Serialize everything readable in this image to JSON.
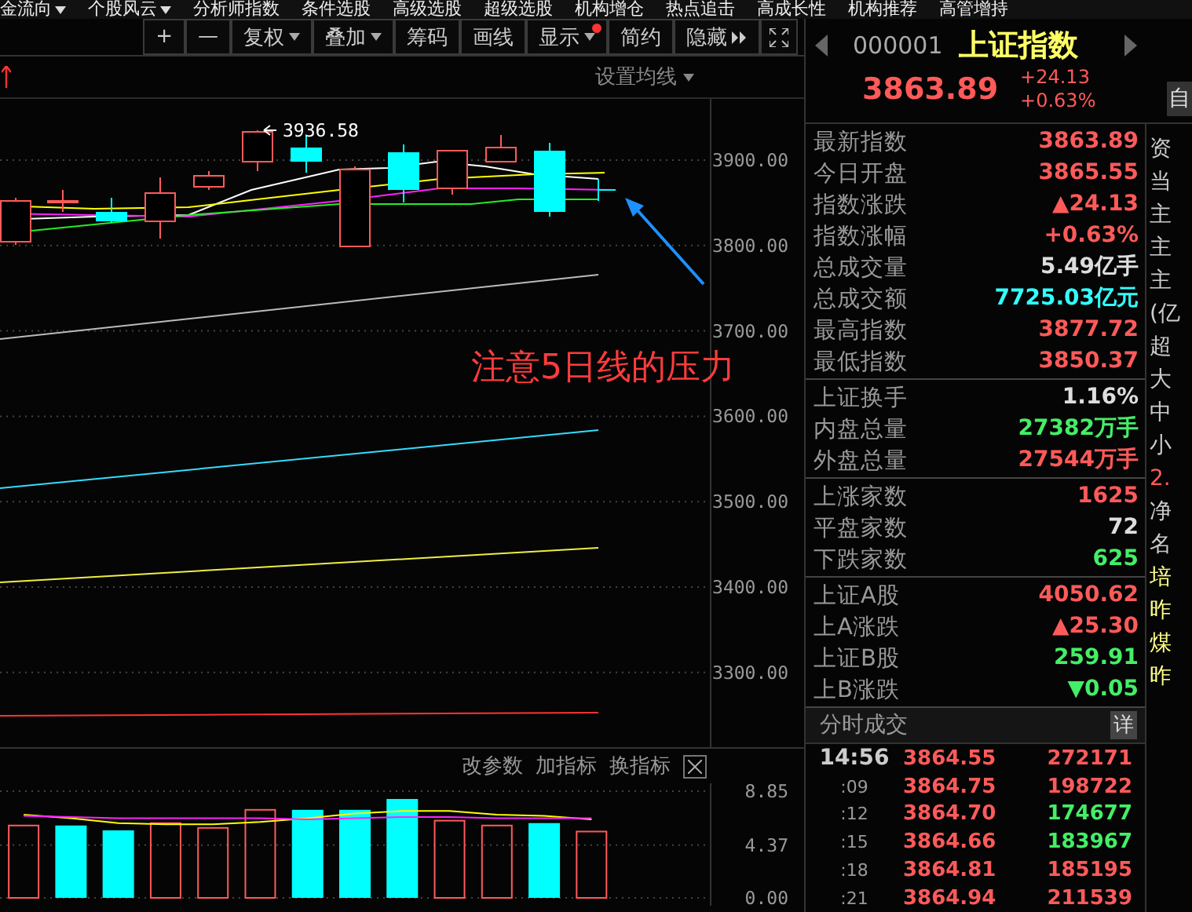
{
  "top_menu": [
    {
      "label": "金流向",
      "dropdown": true
    },
    {
      "label": "个股风云",
      "dropdown": true
    },
    {
      "label": "分析师指数",
      "dropdown": false
    },
    {
      "label": "条件选股",
      "dropdown": false
    },
    {
      "label": "高级选股",
      "dropdown": false
    },
    {
      "label": "超级选股",
      "dropdown": false
    },
    {
      "label": "机构增仓",
      "dropdown": false
    },
    {
      "label": "热点追击",
      "dropdown": false
    },
    {
      "label": "高成长性",
      "dropdown": false
    },
    {
      "label": "机构推荐",
      "dropdown": false
    },
    {
      "label": "高管增持",
      "dropdown": false
    }
  ],
  "toolbar": [
    {
      "label": "+",
      "dropdown": false,
      "dot": false,
      "more": false
    },
    {
      "label": "—",
      "dropdown": false,
      "dot": false,
      "more": false
    },
    {
      "label": "复权",
      "dropdown": true,
      "dot": false,
      "more": false
    },
    {
      "label": "叠加",
      "dropdown": true,
      "dot": false,
      "more": false
    },
    {
      "label": "筹码",
      "dropdown": false,
      "dot": false,
      "more": false
    },
    {
      "label": "画线",
      "dropdown": false,
      "dot": false,
      "more": false
    },
    {
      "label": "显示",
      "dropdown": true,
      "dot": true,
      "more": false
    },
    {
      "label": "简约",
      "dropdown": false,
      "dot": false,
      "more": false
    },
    {
      "label": "隐藏",
      "dropdown": false,
      "dot": false,
      "more": true
    }
  ],
  "chart": {
    "ma_setting": "设置均线",
    "high_label": "3936.58",
    "price_ticks": [
      "3900.00",
      "3800.00",
      "3700.00",
      "3600.00",
      "3500.00",
      "3400.00",
      "3300.00"
    ],
    "annotation": "注意5日线的压力"
  },
  "indicator": {
    "actions": [
      "改参数",
      "加指标",
      "换指标"
    ],
    "chart_data": {
      "type": "bar",
      "ylim": [
        0,
        8.85
      ],
      "yticks": [
        {
          "value": 8.85,
          "label": "8.85"
        },
        {
          "value": 4.37,
          "label": "4.37"
        },
        {
          "value": 0,
          "label": "0.00"
        }
      ],
      "series": [
        {
          "type": "bar",
          "color": "#ff5a5a",
          "values": [
            6.0,
            null,
            null,
            6.2,
            5.8,
            7.3,
            null,
            null,
            null,
            6.4,
            6.0,
            null,
            5.5,
            null,
            null
          ]
        },
        {
          "type": "bar",
          "color": "#00ffff",
          "values": [
            null,
            6.0,
            5.6,
            null,
            null,
            null,
            7.3,
            7.3,
            8.2,
            null,
            null,
            6.2,
            null,
            null,
            null
          ]
        },
        {
          "type": "line",
          "color": "#ffff00",
          "values": [
            6.9,
            6.6,
            6.2,
            6.1,
            6.1,
            6.3,
            6.6,
            7.0,
            7.2,
            7.2,
            6.9,
            6.8,
            6.5,
            null,
            null
          ]
        },
        {
          "type": "line",
          "color": "#ff22ff",
          "values": [
            6.8,
            6.7,
            6.6,
            6.6,
            6.6,
            6.6,
            6.5,
            6.6,
            6.7,
            6.7,
            6.6,
            6.6,
            6.6,
            null,
            null
          ]
        }
      ]
    }
  },
  "quote": {
    "code": "000001",
    "name": "上证指数",
    "price": "3863.89",
    "change": "+24.13",
    "change_pct": "+0.63%",
    "side_button": "自"
  },
  "stats_groups": [
    [
      {
        "label": "最新指数",
        "value": "3863.89",
        "color": "#ff5a5a"
      },
      {
        "label": "今日开盘",
        "value": "3865.55",
        "color": "#ff5a5a"
      },
      {
        "label": "指数涨跌",
        "value": "▲24.13",
        "color": "#ff5a5a"
      },
      {
        "label": "指数涨幅",
        "value": "+0.63%",
        "color": "#ff5a5a"
      },
      {
        "label": "总成交量",
        "value": "5.49亿手",
        "color": "#dddddd"
      },
      {
        "label": "总成交额",
        "value": "7725.03亿元",
        "color": "#33ffff"
      },
      {
        "label": "最高指数",
        "value": "3877.72",
        "color": "#ff5a5a"
      },
      {
        "label": "最低指数",
        "value": "3850.37",
        "color": "#ff5a5a"
      }
    ],
    [
      {
        "label": "上证换手",
        "value": "1.16%",
        "color": "#dddddd"
      },
      {
        "label": "内盘总量",
        "value": "27382万手",
        "color": "#44ee66"
      },
      {
        "label": "外盘总量",
        "value": "27544万手",
        "color": "#ff5a5a"
      }
    ],
    [
      {
        "label": "上涨家数",
        "value": "1625",
        "color": "#ff5a5a"
      },
      {
        "label": "平盘家数",
        "value": "72",
        "color": "#dddddd"
      },
      {
        "label": "下跌家数",
        "value": "625",
        "color": "#44ee66"
      }
    ],
    [
      {
        "label": "上证A股",
        "value": "4050.62",
        "color": "#ff5a5a"
      },
      {
        "label": "上A涨跌",
        "value": "▲25.30",
        "color": "#ff5a5a"
      },
      {
        "label": "上证B股",
        "value": "259.91",
        "color": "#44ee66"
      },
      {
        "label": "上B涨跌",
        "value": "▼0.05",
        "color": "#44ee66"
      }
    ]
  ],
  "trades": {
    "title": "分时成交",
    "detail_button": "详",
    "rows": [
      {
        "time": "14:56",
        "kind": "full",
        "price": "3864.55",
        "volume": "272171",
        "color": "#ff5a5a"
      },
      {
        "time": ":09",
        "kind": "short",
        "price": "3864.75",
        "volume": "198722",
        "color": "#ff5a5a"
      },
      {
        "time": ":12",
        "kind": "short",
        "price": "3864.70",
        "volume": "174677",
        "color": "#44ee66"
      },
      {
        "time": ":15",
        "kind": "short",
        "price": "3864.66",
        "volume": "183967",
        "color": "#44ee66"
      },
      {
        "time": ":18",
        "kind": "short",
        "price": "3864.81",
        "volume": "185195",
        "color": "#ff5a5a"
      },
      {
        "time": ":21",
        "kind": "short",
        "price": "3864.94",
        "volume": "211539",
        "color": "#ff5a5a"
      }
    ]
  },
  "side_panel": [
    {
      "text": "资",
      "color": "#cccccc"
    },
    {
      "text": "当",
      "color": "#cccccc"
    },
    {
      "text": "主",
      "color": "#cccccc"
    },
    {
      "text": "主",
      "color": "#cccccc"
    },
    {
      "text": "主",
      "color": "#cccccc"
    },
    {
      "text": "(亿",
      "color": "#cccccc"
    },
    {
      "text": "超",
      "color": "#cccccc"
    },
    {
      "text": "大",
      "color": "#cccccc"
    },
    {
      "text": "中",
      "color": "#cccccc"
    },
    {
      "text": "小",
      "color": "#cccccc"
    },
    {
      "text": "2.",
      "color": "#ff5a5a"
    },
    {
      "text": "净",
      "color": "#cccccc"
    },
    {
      "text": "名",
      "color": "#cccccc"
    },
    {
      "text": "培",
      "color": "#ffff88"
    },
    {
      "text": "昨",
      "color": "#ffff88"
    },
    {
      "text": "煤",
      "color": "#ffff88"
    },
    {
      "text": "昨",
      "color": "#ffff88"
    }
  ]
}
